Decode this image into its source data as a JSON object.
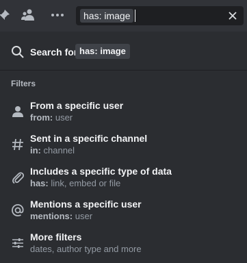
{
  "search": {
    "query_chip": "has: image"
  },
  "popout": {
    "search_for_label": "Search for",
    "search_for_chip": "has: image",
    "section_title": "Filters",
    "filters": [
      {
        "title": "From a specific user",
        "key": "from:",
        "hint": "user",
        "icon": "user-icon"
      },
      {
        "title": "Sent in a specific channel",
        "key": "in:",
        "hint": "channel",
        "icon": "hash-icon"
      },
      {
        "title": "Includes a specific type of data",
        "key": "has:",
        "hint": "link, embed or file",
        "icon": "paperclip-icon"
      },
      {
        "title": "Mentions a specific user",
        "key": "mentions:",
        "hint": "user",
        "icon": "at-icon"
      },
      {
        "title": "More filters",
        "key": "",
        "hint": "dates, author type and more",
        "icon": "sliders-icon"
      }
    ]
  },
  "colors": {
    "topbar": "#313338",
    "panel": "#2b2d31",
    "chip": "#3f4248",
    "text_primary": "#f2f3f5",
    "text_muted": "#949ba4"
  }
}
